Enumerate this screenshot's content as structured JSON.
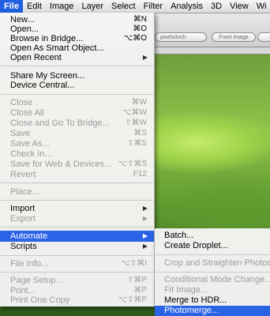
{
  "menubar": {
    "items": [
      "File",
      "Edit",
      "Image",
      "Layer",
      "Select",
      "Filter",
      "Analysis",
      "3D",
      "View",
      "Wi"
    ]
  },
  "options": {
    "units": "pixels/inch",
    "front_image": "Front Image"
  },
  "file_menu": {
    "items": [
      {
        "label": "New...",
        "shortcut": "⌘N"
      },
      {
        "label": "Open...",
        "shortcut": "⌘O"
      },
      {
        "label": "Browse in Bridge...",
        "shortcut": "⌥⌘O"
      },
      {
        "label": "Open As Smart Object..."
      },
      {
        "label": "Open Recent",
        "submenu": true
      },
      {
        "label": "Share My Screen..."
      },
      {
        "label": "Device Central..."
      },
      {
        "label": "Close",
        "shortcut": "⌘W"
      },
      {
        "label": "Close All",
        "shortcut": "⌥⌘W"
      },
      {
        "label": "Close and Go To Bridge...",
        "shortcut": "⇧⌘W"
      },
      {
        "label": "Save",
        "shortcut": "⌘S"
      },
      {
        "label": "Save As...",
        "shortcut": "⇧⌘S"
      },
      {
        "label": "Check In..."
      },
      {
        "label": "Save for Web & Devices...",
        "shortcut": "⌥⇧⌘S"
      },
      {
        "label": "Revert",
        "shortcut": "F12"
      },
      {
        "label": "Place..."
      },
      {
        "label": "Import",
        "submenu": true
      },
      {
        "label": "Export",
        "submenu": true
      },
      {
        "label": "Automate",
        "submenu": true
      },
      {
        "label": "Scripts",
        "submenu": true
      },
      {
        "label": "File Info...",
        "shortcut": "⌥⇧⌘I"
      },
      {
        "label": "Page Setup...",
        "shortcut": "⇧⌘P"
      },
      {
        "label": "Print...",
        "shortcut": "⌘P"
      },
      {
        "label": "Print One Copy",
        "shortcut": "⌥⇧⌘P"
      }
    ]
  },
  "automate_menu": {
    "items": [
      {
        "label": "Batch..."
      },
      {
        "label": "Create Droplet..."
      },
      {
        "label": "Crop and Straighten Photos"
      },
      {
        "label": "Conditional Mode Change..."
      },
      {
        "label": "Fit Image..."
      },
      {
        "label": "Merge to HDR..."
      },
      {
        "label": "Photomerge..."
      }
    ]
  },
  "colors": {
    "highlight": "#2a63e6",
    "disabled_text": "#9b9b9b"
  }
}
